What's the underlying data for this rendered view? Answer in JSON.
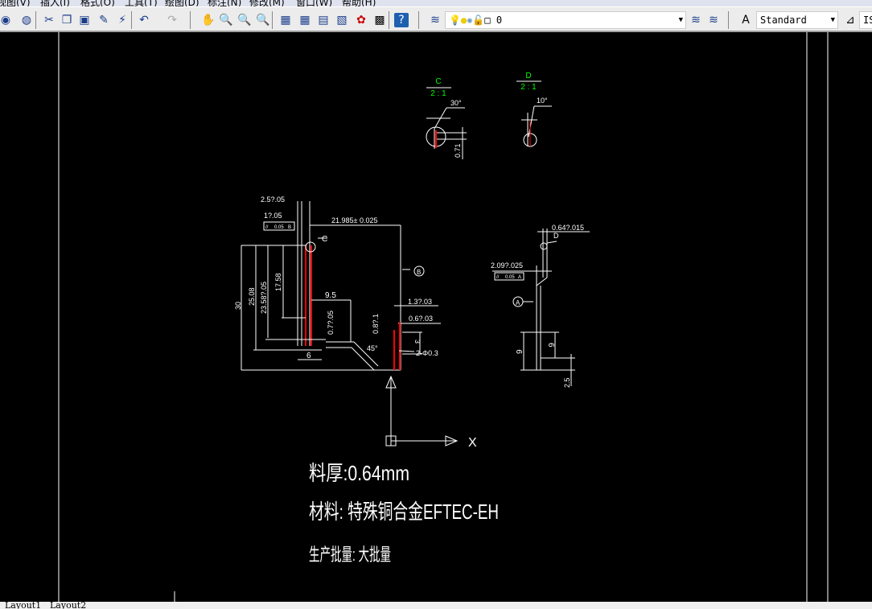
{
  "menu": [
    "视图(V)",
    "插入(I)",
    "格式(O)",
    "工具(T)",
    "绘图(D)",
    "标注(N)",
    "修改(M)",
    "窗口(W)",
    "帮助(H)"
  ],
  "layer_combo": {
    "value": "0"
  },
  "text_style_combo": {
    "value": "Standard"
  },
  "dim_style_combo": {
    "value": "IS"
  },
  "drawing": {
    "detail_c": {
      "label": "C",
      "scale": "2 : 1",
      "angle": "30°",
      "dim": "0.71"
    },
    "detail_d": {
      "label": "D",
      "scale": "2 : 1",
      "angle": "10°"
    },
    "front": {
      "d1": "2.5?.05",
      "d2": "1?.05",
      "tol": [
        "//",
        "0.05",
        "B"
      ],
      "d3": "21.985± 0.025",
      "c": "C",
      "b": "B",
      "d30": "30",
      "d2508": "25.08",
      "d2358": "23.58?.05",
      "d1758": "17.58",
      "d95": "9.5",
      "d077": "0.7?.05",
      "d087": "0.8?.1",
      "d45": "45°",
      "d137": "1.3?.03",
      "d062": "0.6?.03",
      "d3b": "3",
      "dhole": "2-Φ0.3",
      "d6": "6"
    },
    "side": {
      "d064": "0.64?.015",
      "d": "D",
      "d209": "2.09?.025",
      "tol": [
        "//",
        "0.05",
        "A"
      ],
      "a": "A",
      "d9": "9",
      "d6": "6",
      "d25": "2.5"
    },
    "ucs_x": "X",
    "notes": [
      "料厚:0.64mm",
      "材料: 特殊铜合金EFTEC-EH",
      "生产批量: 大批量"
    ]
  },
  "tabs": [
    "Layout1",
    "Layout2"
  ]
}
